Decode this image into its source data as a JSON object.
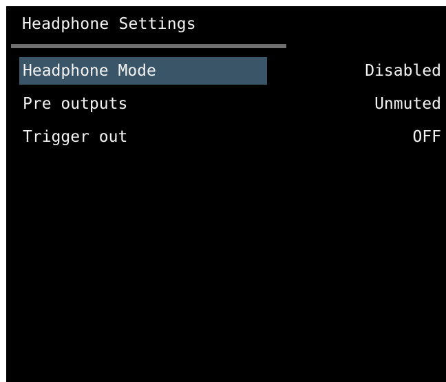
{
  "screen": {
    "title": "Headphone Settings"
  },
  "colors": {
    "background": "#000000",
    "text": "#f2f2f2",
    "divider": "#6e6e6e",
    "selection": "#3a5568"
  },
  "menu": {
    "selected_index": 0,
    "items": [
      {
        "label": "Headphone Mode",
        "value": "Disabled"
      },
      {
        "label": "Pre outputs",
        "value": "Unmuted"
      },
      {
        "label": "Trigger out",
        "value": "OFF"
      }
    ]
  }
}
